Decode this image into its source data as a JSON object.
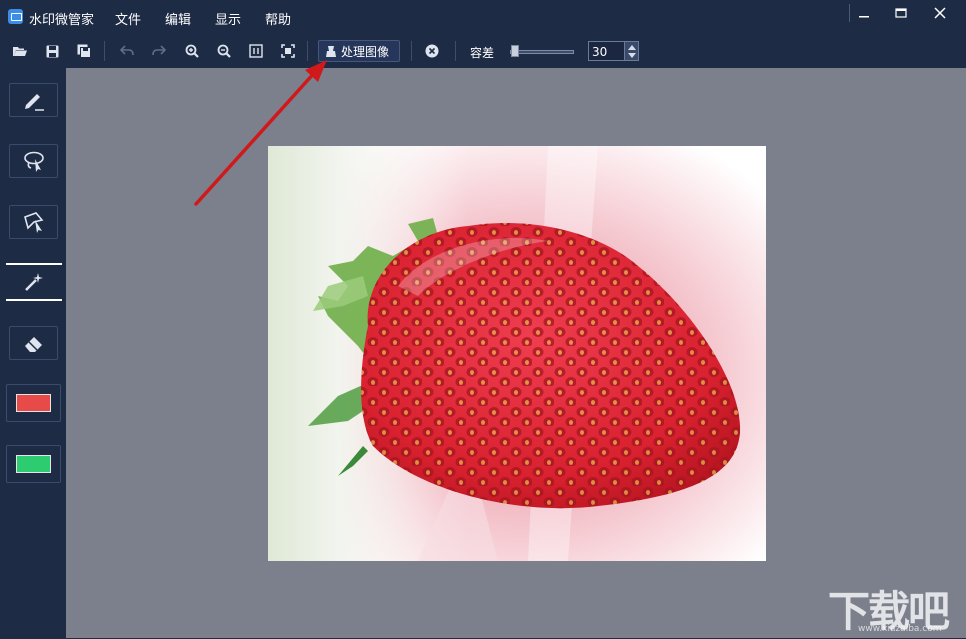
{
  "app": {
    "title": "水印微管家"
  },
  "menu": {
    "file": "文件",
    "edit": "编辑",
    "view": "显示",
    "help": "帮助"
  },
  "window_controls": [
    "minimize-icon",
    "maximize-icon",
    "close-icon"
  ],
  "toolbar": {
    "icons": [
      "open-icon",
      "save-icon",
      "save-as-icon",
      "undo-icon",
      "redo-icon",
      "zoom-in-icon",
      "zoom-out-icon",
      "actual-size-icon",
      "fit-window-icon"
    ],
    "process_label": "处理图像",
    "tolerance_label": "容差",
    "tolerance_value": "30",
    "tolerance_slider_level": 0.05
  },
  "sidebar": {
    "tools": [
      "pen-icon",
      "lasso-icon",
      "polygon-lasso-icon",
      "magic-wand-icon",
      "eraser-icon"
    ],
    "active_tool": "magic-wand-icon",
    "foreground_color": "#e84a4a",
    "background_color": "#2ecc71"
  },
  "colors": {
    "chrome": "#1e2b45",
    "canvas": "#7b808c",
    "accent": "#3a8de8",
    "annotation": "#d0191b"
  },
  "watermark": {
    "text": "下载吧",
    "url": "www.xiazaiba.com"
  }
}
